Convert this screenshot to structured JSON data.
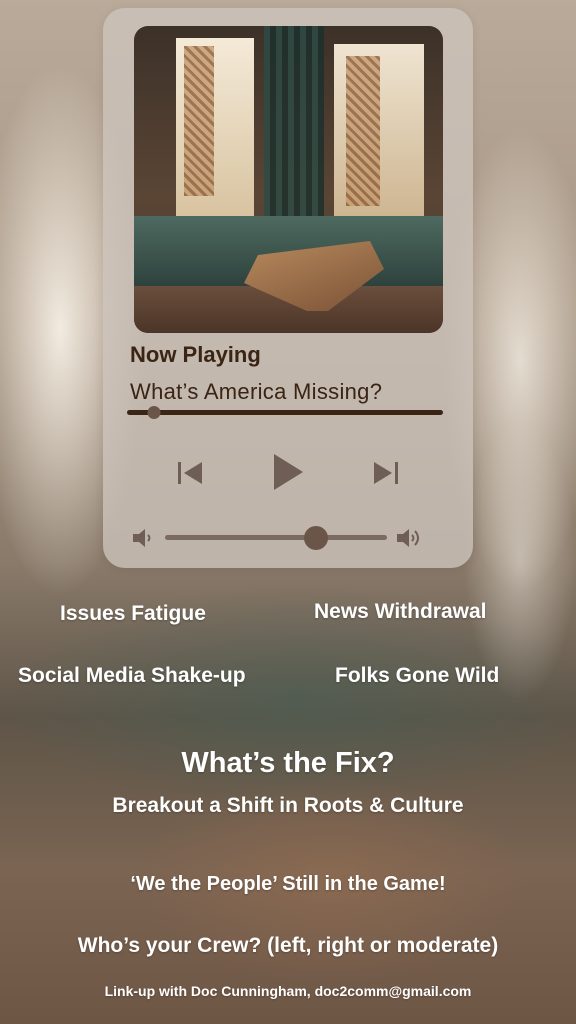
{
  "player": {
    "now_playing_label": "Now Playing",
    "track_title": "What’s America Missing?",
    "progress_fraction": 0.085,
    "volume_fraction": 0.68,
    "controls": {
      "prev_icon": "skip-previous-icon",
      "play_icon": "play-icon",
      "next_icon": "skip-next-icon",
      "volume_low_icon": "volume-low-icon",
      "volume_high_icon": "volume-high-icon"
    },
    "accent_color": "#3a2414"
  },
  "topics": {
    "issues": "Issues Fatigue",
    "news": "News Withdrawal",
    "social": "Social Media Shake-up",
    "folks": "Folks Gone Wild"
  },
  "fix": {
    "heading": "What’s the Fix?",
    "subheading": "Breakout a Shift in Roots & Culture",
    "people": "‘We the People’ Still in the Game!",
    "crew": "Who’s your Crew? (left, right or moderate)",
    "contact": "Link-up with Doc Cunningham, doc2comm@gmail.com"
  }
}
